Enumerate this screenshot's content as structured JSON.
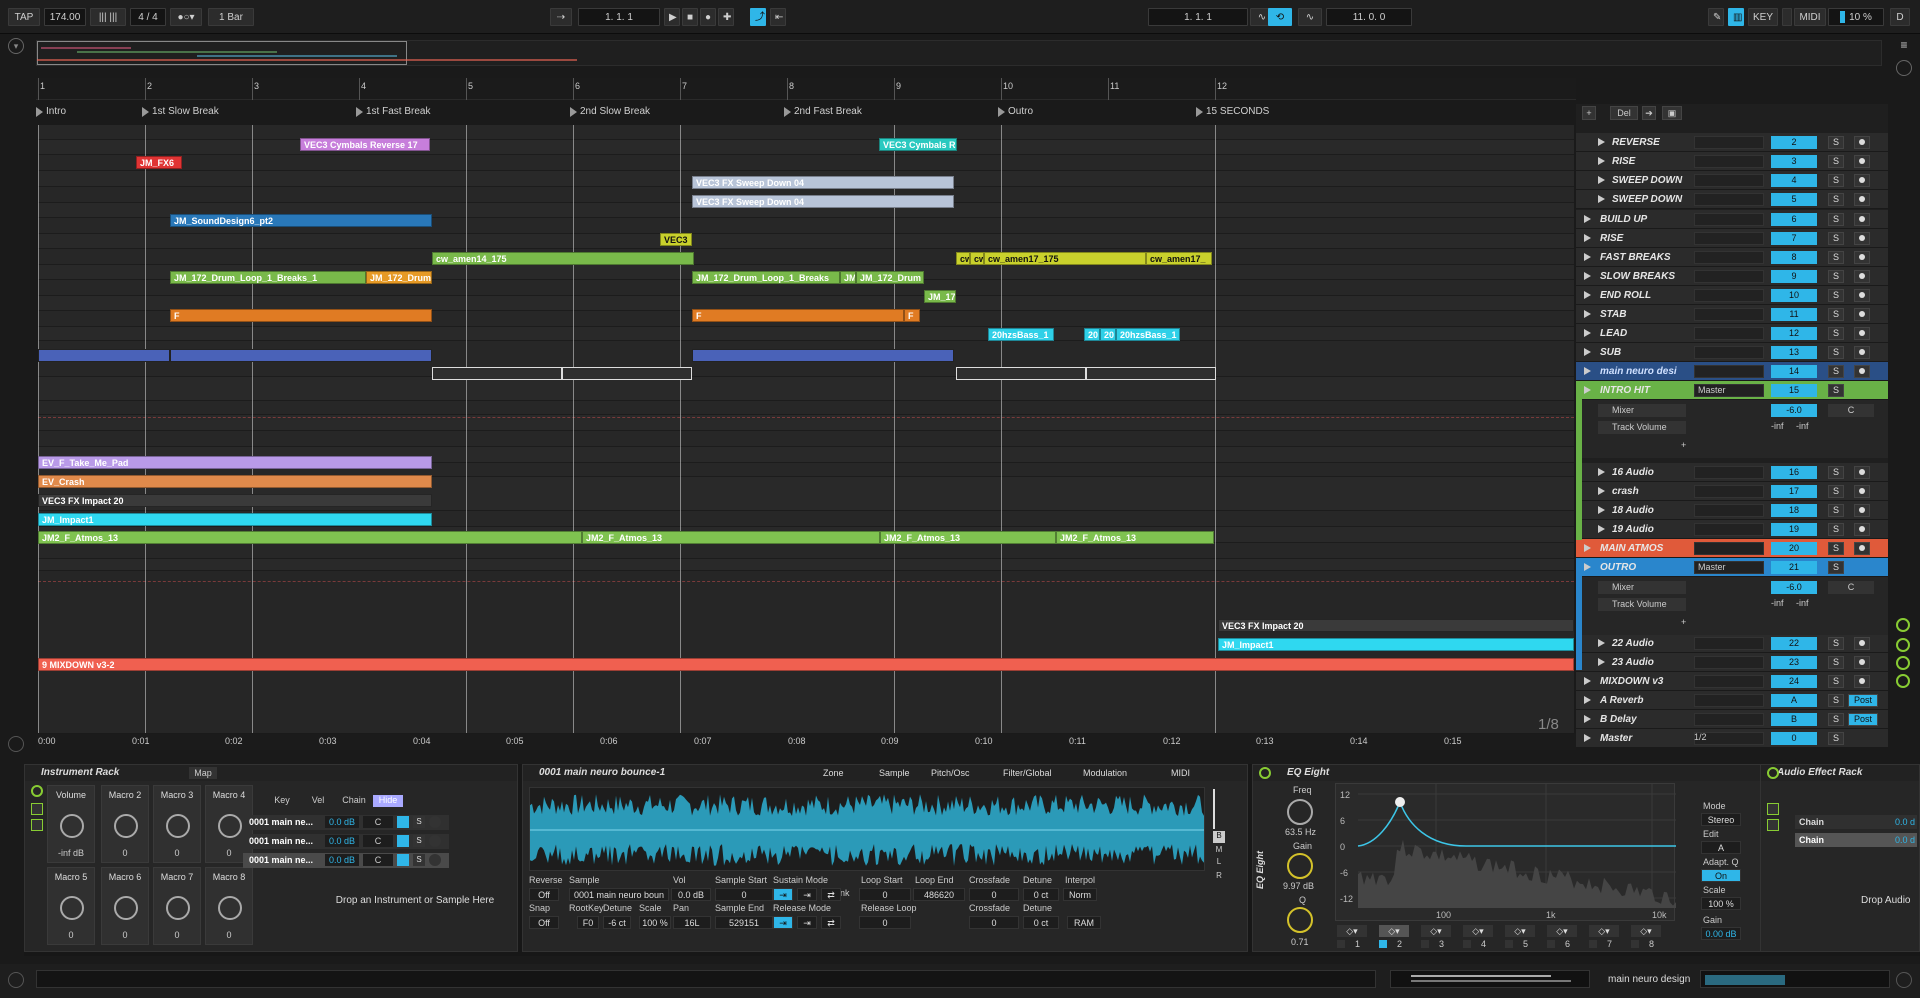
{
  "transport": {
    "tap": "TAP",
    "tempo": "174.00",
    "sig": "4 / 4",
    "quant": "1 Bar",
    "pos": "1.   1.   1",
    "loop_start": "1.   1.   1",
    "loop_len": "11.   0.   0",
    "key": "KEY",
    "midi": "MIDI",
    "cpu": "10 %",
    "d": "D"
  },
  "ruler": {
    "bars": [
      "1",
      "2",
      "3",
      "4",
      "5",
      "6",
      "7",
      "8",
      "9",
      "10",
      "11",
      "12"
    ]
  },
  "locators": [
    "Intro",
    "1st Slow Break",
    "1st Fast Break",
    "2nd Slow Break",
    "2nd Fast Break",
    "Outro",
    "15 SECONDS"
  ],
  "clips": [
    {
      "t": "VEC3 Cymbals Reverse 17"
    },
    {
      "t": "VEC3 Cymbals R"
    },
    {
      "t": "JM_FX6"
    },
    {
      "t": "VEC3 FX Sweep Down 04"
    },
    {
      "t": "VEC3 FX Sweep Down 04"
    },
    {
      "t": "JM_SoundDesign6_pt2"
    },
    {
      "t": "VEC3"
    },
    {
      "t": "cw_amen14_175"
    },
    {
      "t": "cw"
    },
    {
      "t": "cw"
    },
    {
      "t": "cw_amen17_175"
    },
    {
      "t": "cw_amen17_"
    },
    {
      "t": "JM_172_Drum_Loop_1_Breaks_1"
    },
    {
      "t": "JM_172_Drum"
    },
    {
      "t": "JM_172_Drum_Loop_1_Breaks"
    },
    {
      "t": "JM"
    },
    {
      "t": "JM_172_Drum"
    },
    {
      "t": "JM_17"
    },
    {
      "t": "F"
    },
    {
      "t": "F"
    },
    {
      "t": "F"
    },
    {
      "t": "20hzsBass_1"
    },
    {
      "t": "20"
    },
    {
      "t": "20"
    },
    {
      "t": "20hzsBass_1"
    },
    {
      "t": "EV_F_Take_Me_Pad"
    },
    {
      "t": "EV_Crash"
    },
    {
      "t": "VEC3 FX Impact 20"
    },
    {
      "t": "JM_Impact1"
    },
    {
      "t": "JM2_F_Atmos_13"
    },
    {
      "t": "JM2_F_Atmos_13"
    },
    {
      "t": "JM2_F_Atmos_13"
    },
    {
      "t": "JM2_F_Atmos_13"
    },
    {
      "t": "VEC3 FX Impact 20"
    },
    {
      "t": "JM_Impact1"
    },
    {
      "t": "9 MIXDOWN v3-2"
    }
  ],
  "tracks": [
    {
      "name": "REVERSE",
      "num": "2"
    },
    {
      "name": "RISE",
      "num": "3"
    },
    {
      "name": "SWEEP DOWN",
      "num": "4"
    },
    {
      "name": "SWEEP DOWN",
      "num": "5"
    },
    {
      "name": "BUILD UP",
      "num": "6"
    },
    {
      "name": "RISE",
      "num": "7"
    },
    {
      "name": "FAST BREAKS",
      "num": "8"
    },
    {
      "name": "SLOW BREAKS",
      "num": "9"
    },
    {
      "name": "END ROLL",
      "num": "10"
    },
    {
      "name": "STAB",
      "num": "11"
    },
    {
      "name": "LEAD",
      "num": "12"
    },
    {
      "name": "SUB",
      "num": "13"
    },
    {
      "name": "main neuro desi",
      "num": "14"
    },
    {
      "name": "INTRO HIT",
      "num": "15"
    },
    {
      "name": "16 Audio",
      "num": "16"
    },
    {
      "name": "crash",
      "num": "17"
    },
    {
      "name": "18 Audio",
      "num": "18"
    },
    {
      "name": "19 Audio",
      "num": "19"
    },
    {
      "name": "MAIN ATMOS",
      "num": "20"
    },
    {
      "name": "OUTRO",
      "num": "21"
    },
    {
      "name": "22 Audio",
      "num": "22"
    },
    {
      "name": "23 Audio",
      "num": "23"
    },
    {
      "name": "MIXDOWN v3",
      "num": "24"
    },
    {
      "name": "A Reverb",
      "num": "A"
    },
    {
      "name": "B Delay",
      "num": "B"
    },
    {
      "name": "Master",
      "num": "0"
    }
  ],
  "group_sub": {
    "master": "Master",
    "mixer": "Mixer",
    "track_volume": "Track Volume",
    "vol": "-6.0",
    "pan": "C",
    "inf1": "-inf",
    "inf2": "-inf",
    "del": "Del",
    "s": "S",
    "post": "Post",
    "half": "1/2"
  },
  "timeline": [
    "0:00",
    "0:01",
    "0:02",
    "0:03",
    "0:04",
    "0:05",
    "0:06",
    "0:07",
    "0:08",
    "0:09",
    "0:10",
    "0:11",
    "0:12",
    "0:13",
    "0:14",
    "0:15"
  ],
  "zoom": "1/8",
  "rack": {
    "title": "Instrument Rack",
    "map": "Map",
    "macros": [
      "Volume",
      "Macro 2",
      "Macro 3",
      "Macro 4",
      "Macro 5",
      "Macro 6",
      "Macro 7",
      "Macro 8"
    ],
    "vals": [
      "-inf dB",
      "0",
      "0",
      "0",
      "0",
      "0",
      "0",
      "0"
    ],
    "key": "Key",
    "vel": "Vel",
    "chain": "Chain",
    "hide": "Hide",
    "chains": [
      "0001 main ne...",
      "0001 main ne...",
      "0001 main ne..."
    ],
    "db": "0.0 dB",
    "c": "C",
    "drop": "Drop an Instrument or Sample Here"
  },
  "sampler": {
    "title": "0001 main neuro bounce-1",
    "tabs": [
      "Zone",
      "Sample",
      "Pitch/Osc",
      "Filter/Global",
      "Modulation",
      "MIDI"
    ],
    "labels": {
      "reverse": "Reverse",
      "off": "Off",
      "sample": "Sample",
      "sample_val": "0001 main neuro boun",
      "vol": "Vol",
      "vol_val": "0.0 dB",
      "sstart": "Sample Start",
      "sstart_val": "0",
      "sustain": "Sustain Mode",
      "link": "Link",
      "lstart": "Loop Start",
      "lstart_val": "0",
      "lend": "Loop End",
      "lend_val": "486620",
      "xfade": "Crossfade",
      "xfade_val": "0",
      "detune": "Detune",
      "detune_val": "0 ct",
      "interp": "Interpol",
      "interp_val": "Norm",
      "snap": "Snap",
      "snap_val": "Off",
      "rootkey": "RootKey",
      "rootkey_val": "F0",
      "detune2": "Detune",
      "detune2_val": "-6 ct",
      "scale": "Scale",
      "scale_val": "100 %",
      "pan": "Pan",
      "pan_val": "16L",
      "send": "Sample End",
      "send_val": "529151",
      "release": "Release Mode",
      "rloop": "Release Loop",
      "rloop_val": "0",
      "xfade2": "Crossfade",
      "xfade2_val": "0",
      "detune3": "Detune",
      "detune3_val": "0 ct",
      "ram": "RAM",
      "m": "M",
      "l": "L",
      "r": "R",
      "b": "B"
    }
  },
  "eq": {
    "title": "EQ Eight",
    "freq": "Freq",
    "freq_val": "63.5 Hz",
    "gain": "Gain",
    "gain_val": "9.97 dB",
    "q": "Q",
    "q_val": "0.71",
    "mode": "Mode",
    "mode_val": "Stereo",
    "edit": "Edit",
    "edit_val": "A",
    "adapt": "Adapt. Q",
    "adapt_val": "On",
    "scale": "Scale",
    "scale_val": "100 %",
    "gain2": "Gain",
    "gain2_val": "0.00 dB",
    "ylabels": [
      "12",
      "6",
      "0",
      "-6",
      "-12"
    ],
    "xlabels": [
      "100",
      "1k",
      "10k"
    ],
    "bands": [
      "1",
      "2",
      "3",
      "4",
      "5",
      "6",
      "7",
      "8"
    ],
    "side": "EQ Eight"
  },
  "fxrack": {
    "title": "Audio Effect Rack",
    "chains": [
      "Chain",
      "Chain"
    ],
    "db": "0.0 d",
    "drop": "Drop Audio"
  },
  "status": {
    "track": "main neuro design"
  }
}
